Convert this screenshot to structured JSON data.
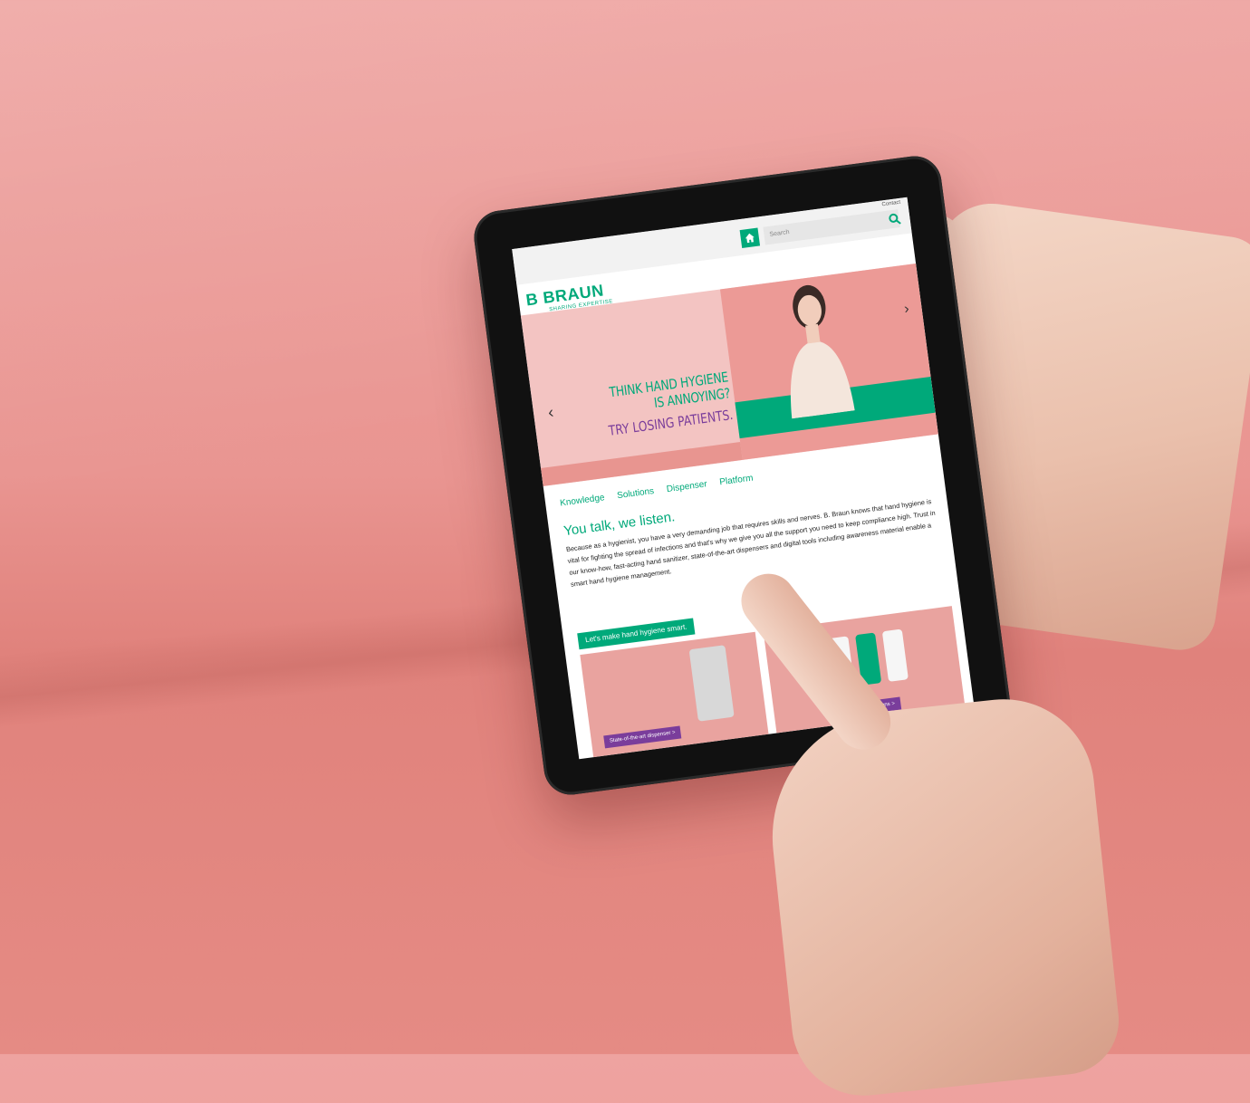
{
  "screen": {
    "topbar": {
      "contact_link": "Contact",
      "search_placeholder": "Search",
      "home_icon": "home-icon",
      "search_icon": "search-icon"
    },
    "logo": {
      "brand": "B BRAUN",
      "tagline": "SHARING EXPERTISE"
    },
    "hero": {
      "line1": "THINK HAND HYGIENE",
      "line2": "IS ANNOYING?",
      "line3": "TRY LOSING PATIENTS."
    },
    "nav": {
      "items": [
        "Knowledge",
        "Solutions",
        "Dispenser",
        "Platform"
      ]
    },
    "content": {
      "title": "You talk, we listen.",
      "body": "Because as a hygienist, you have a very demanding job that requires skills and nerves. B. Braun knows that hand hygiene is vital for fighting the spread of infections and that's why we give you all the support you need to keep compliance high. Trust in our know-how, fast-acting hand sanitizer, state-of-the-art dispensers and digital tools including awareness material enable a smart hand hygiene management.",
      "cta": "Let's make hand hygiene smart."
    },
    "cards": [
      {
        "label": "State-of-the-art dispenser >"
      },
      {
        "label": "Hand hygiene solutions >"
      }
    ]
  },
  "colors": {
    "brand_green": "#00a97a",
    "accent_purple": "#7a3d9b",
    "background_pink": "#e99591"
  }
}
